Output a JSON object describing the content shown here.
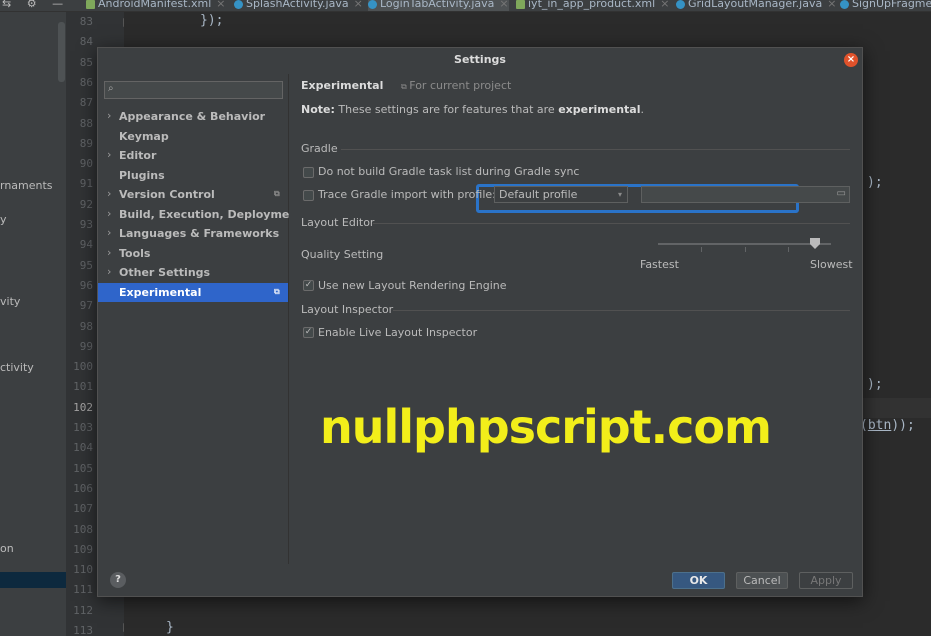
{
  "editor_tabs": [
    {
      "label": "AndroidManifest.xml",
      "kind": "xml"
    },
    {
      "label": "SplashActivity.java",
      "kind": "java"
    },
    {
      "label": "LoginTabActivity.java",
      "kind": "java"
    },
    {
      "label": "iyt_in_app_product.xml",
      "kind": "xml"
    },
    {
      "label": "GridLayoutManager.java",
      "kind": "java"
    },
    {
      "label": "SignUpFragment",
      "kind": "java"
    }
  ],
  "project_pane": {
    "items": [
      "rnaments",
      "y",
      "vity",
      "ctivity",
      "on"
    ]
  },
  "gutter": {
    "lines": [
      "83",
      "84",
      "85",
      "86",
      "87",
      "88",
      "89",
      "90",
      "91",
      "92",
      "93",
      "94",
      "95",
      "96",
      "97",
      "98",
      "99",
      "100",
      "101",
      "102",
      "103",
      "104",
      "105",
      "106",
      "107",
      "108",
      "109",
      "110",
      "111",
      "112",
      "113"
    ],
    "current_line": "102"
  },
  "code": {
    "line_83": "});",
    "line_91_tail": ");",
    "line_101_tail": ");",
    "line_103_prefix": "(",
    "line_103_link": "btn",
    "line_103_suffix": "));",
    "line_113": "}"
  },
  "dialog": {
    "title": "Settings",
    "search_placeholder": "",
    "nav": [
      {
        "label": "Appearance & Behavior",
        "expandable": true,
        "scoped": false
      },
      {
        "label": "Keymap",
        "expandable": false,
        "scoped": false
      },
      {
        "label": "Editor",
        "expandable": true,
        "scoped": false
      },
      {
        "label": "Plugins",
        "expandable": false,
        "scoped": false
      },
      {
        "label": "Version Control",
        "expandable": true,
        "scoped": true
      },
      {
        "label": "Build, Execution, Deployment",
        "expandable": true,
        "scoped": false
      },
      {
        "label": "Languages & Frameworks",
        "expandable": true,
        "scoped": false
      },
      {
        "label": "Tools",
        "expandable": true,
        "scoped": false
      },
      {
        "label": "Other Settings",
        "expandable": true,
        "scoped": false
      },
      {
        "label": "Experimental",
        "expandable": false,
        "scoped": true,
        "selected": true
      }
    ],
    "panel": {
      "title": "Experimental",
      "scope_label": "For current project",
      "note_prefix": "Note:",
      "note_text": " These settings are for features that are ",
      "note_bold": "experimental",
      "note_end": ".",
      "gradle_section": "Gradle",
      "gradle_option_1": "Do not build Gradle task list during Gradle sync",
      "gradle_option_1_checked": false,
      "gradle_option_2": "Trace Gradle import with profile:",
      "gradle_option_2_checked": false,
      "profile_select": "Default profile",
      "profile_path": "",
      "layout_editor_section": "Layout Editor",
      "quality_label": "Quality Setting",
      "quality_min": "Fastest",
      "quality_max": "Slowest",
      "quality_level": 0.91,
      "layout_rendering_option": "Use new Layout Rendering Engine",
      "layout_rendering_checked": true,
      "layout_inspector_section": "Layout Inspector",
      "live_inspector_option": "Enable Live Layout Inspector",
      "live_inspector_checked": true
    },
    "buttons": {
      "help": "?",
      "ok": "OK",
      "cancel": "Cancel",
      "apply": "Apply"
    }
  },
  "watermark": "nullphpscript.com",
  "colors": {
    "accent_selected": "#2f65ca",
    "highlight_box": "#2a73c8",
    "close_button": "#e0522b",
    "watermark": "#f2ee1a"
  }
}
